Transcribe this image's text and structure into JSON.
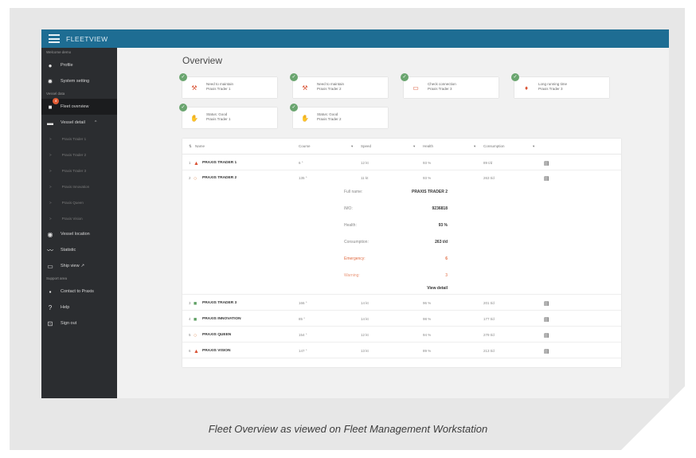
{
  "app": {
    "title": "FLEETVIEW"
  },
  "sidebar": {
    "section_welcome": "Welcome demo",
    "profile": "Profile",
    "system_setting": "System setting",
    "section_vessel": "Vessel data",
    "fleet_overview": "Fleet overview",
    "fleet_badge": "4",
    "vessel_detail": "Vessel detail",
    "subitems": [
      "Praxis Trader 1",
      "Praxis Trader 2",
      "Praxis Trader 3",
      "Praxis Innovation",
      "Praxis Queen",
      "Praxis Vision"
    ],
    "vessel_location": "Vessel location",
    "statistic": "Statistic",
    "ship_view": "Ship view",
    "section_support": "Support area",
    "contact": "Contact to Praxis",
    "help": "Help",
    "sign_out": "Sign out"
  },
  "main": {
    "title": "Overview",
    "cards": [
      {
        "line1": "Need to maintain",
        "line2": "Praxis Trader 1",
        "icon": "wrench-icon"
      },
      {
        "line1": "Need to maintain",
        "line2": "Praxis Trader 2",
        "icon": "wrench-icon"
      },
      {
        "line1": "Check connection",
        "line2": "Praxis Trader 3",
        "icon": "connection-icon"
      },
      {
        "line1": "Long running time",
        "line2": "Praxis Trader 3",
        "icon": "fire-icon"
      },
      {
        "line1": "Status: Good",
        "line2": "Praxis Trader 1",
        "icon": "thumbs-up-icon"
      },
      {
        "line1": "Status: Good",
        "line2": "Praxis Trader 2",
        "icon": "thumbs-up-icon"
      }
    ],
    "table": {
      "headers": {
        "name": "Name",
        "course": "Course",
        "speed": "Speed",
        "health": "Health",
        "consumption": "Consumption"
      },
      "rows": [
        {
          "num": "1",
          "status": "warning",
          "name": "PRAXIS TRADER 1",
          "course": "6 °",
          "speed": "12 kt",
          "health": "93 %",
          "consumption": "89 t/d"
        },
        {
          "num": "2",
          "status": "alert",
          "name": "PRAXIS TRADER 2",
          "course": "135 °",
          "speed": "11 kt",
          "health": "93 %",
          "consumption": "263 t/d"
        },
        {
          "num": "3",
          "status": "ok",
          "name": "PRAXIS TRADER 3",
          "course": "166 °",
          "speed": "14 kt",
          "health": "96 %",
          "consumption": "201 t/d"
        },
        {
          "num": "4",
          "status": "ok",
          "name": "PRAXIS INNOVATION",
          "course": "85 °",
          "speed": "14 kt",
          "health": "98 %",
          "consumption": "177 t/d"
        },
        {
          "num": "5",
          "status": "alert",
          "name": "PRAXIS QUEEN",
          "course": "154 °",
          "speed": "12 kt",
          "health": "94 %",
          "consumption": "279 t/d"
        },
        {
          "num": "6",
          "status": "warning",
          "name": "PRAXIS VISION",
          "course": "147 °",
          "speed": "13 kt",
          "health": "89 %",
          "consumption": "213 t/d"
        }
      ],
      "detail": {
        "full_name_label": "Full name:",
        "full_name": "PRAXIS TRADER 2",
        "imo_label": "IMO:",
        "imo": "9236818",
        "health_label": "Health:",
        "health": "93 %",
        "consumption_label": "Consumption:",
        "consumption": "263 t/d",
        "emergency_label": "Emergency:",
        "emergency": "6",
        "warning_label": "Warning:",
        "warning": "3",
        "view_detail": "View detail"
      }
    }
  },
  "caption": "Fleet Overview as viewed on Fleet Management Workstation",
  "colors": {
    "topbar": "#1e6d93",
    "sidebar": "#2b2d30",
    "alert": "#d95031",
    "ok": "#5e9f63"
  }
}
